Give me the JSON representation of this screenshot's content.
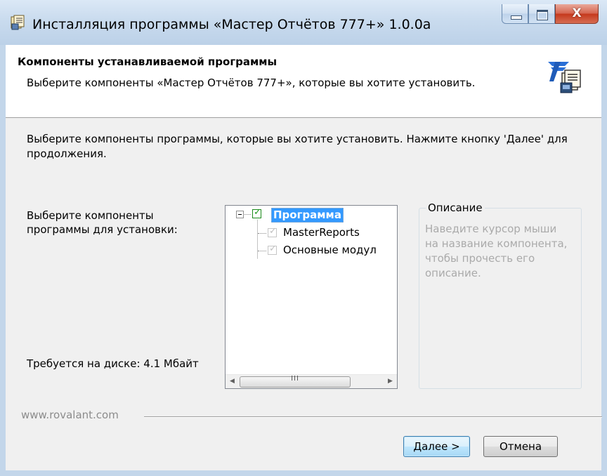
{
  "window": {
    "title": "Инсталляция программы «Мастер Отчётов 777+» 1.0.0a",
    "buttons": {
      "minimize": "–",
      "maximize": "□",
      "close": "X"
    }
  },
  "header": {
    "title": "Компоненты устанавливаемой программы",
    "subtitle": "Выберите компоненты «Мастер Отчётов 777+», которые вы хотите установить."
  },
  "main": {
    "instruction": "Выберите компоненты программы, которые вы хотите установить. Нажмите кнопку 'Далее' для продолжения.",
    "select_label": "Выберите компоненты программы для установки:",
    "disk_space": "Требуется на диске: 4.1 Мбайт"
  },
  "tree": {
    "root": {
      "label": "Программа",
      "checked": true,
      "selected": true
    },
    "children": [
      {
        "label": "MasterReports",
        "checked": true,
        "enabled": false
      },
      {
        "label": "Основные модул",
        "checked": true,
        "enabled": false
      }
    ],
    "scroll_grip": "III"
  },
  "description": {
    "legend": "Описание",
    "text": "Наведите курсор мыши на название компонента, чтобы прочесть его описание."
  },
  "footer": {
    "brand": "www.rovalant.com",
    "next_label": "Далее >",
    "cancel_label": "Отмена"
  },
  "colors": {
    "titlebar": "#c9dbee",
    "selection": "#3399ff",
    "check_green": "#219a21",
    "disabled_text": "#aaaaaa"
  }
}
